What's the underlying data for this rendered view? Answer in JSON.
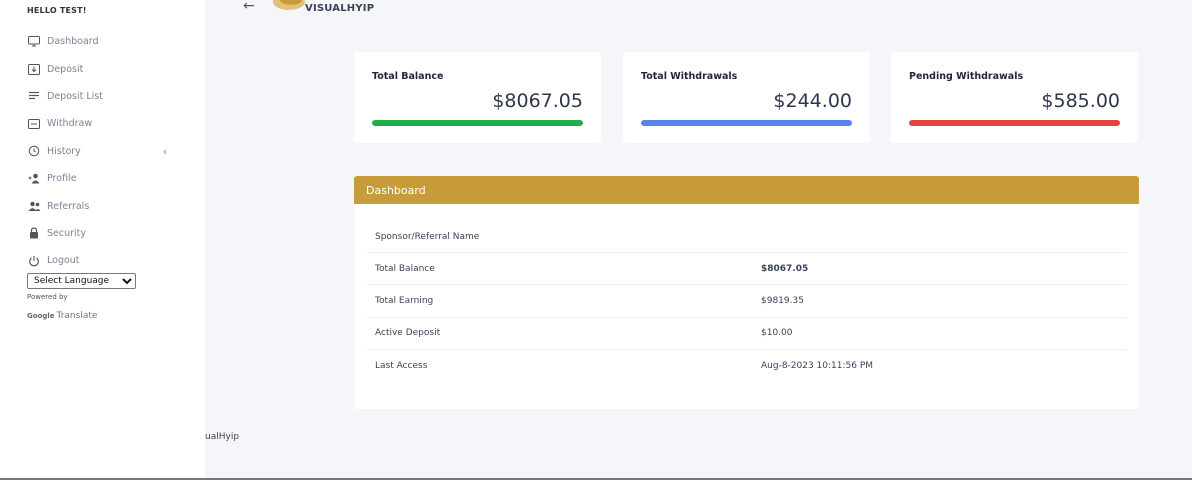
{
  "sidebar": {
    "greeting": "HELLO TEST!",
    "items": [
      {
        "label": "Dashboard",
        "icon": "monitor-icon"
      },
      {
        "label": "Deposit",
        "icon": "deposit-icon"
      },
      {
        "label": "Deposit List",
        "icon": "list-icon"
      },
      {
        "label": "Withdraw",
        "icon": "withdraw-icon"
      },
      {
        "label": "History",
        "icon": "history-icon",
        "caret": "‹"
      },
      {
        "label": "Profile",
        "icon": "profile-icon"
      },
      {
        "label": "Referrals",
        "icon": "users-icon"
      },
      {
        "label": "Security",
        "icon": "lock-icon"
      },
      {
        "label": "Logout",
        "icon": "power-icon"
      }
    ],
    "language_select": "Select Language",
    "powered_by": "Powered by",
    "google": "Google",
    "translate": "Translate"
  },
  "topbar": {
    "back": "←",
    "brand": "VISUALHYIP"
  },
  "cards": [
    {
      "title": "Total Balance",
      "value": "$8067.05",
      "color": "#20b04b"
    },
    {
      "title": "Total Withdrawals",
      "value": "$244.00",
      "color": "#5b82e8"
    },
    {
      "title": "Pending Withdrawals",
      "value": "$585.00",
      "color": "#e04443"
    }
  ],
  "panel": {
    "title": "Dashboard",
    "rows": [
      {
        "label": "Sponsor/Referral Name",
        "value": ""
      },
      {
        "label": "Total Balance",
        "value": "$8067.05"
      },
      {
        "label": "Total Earning",
        "value": "$9819.35"
      },
      {
        "label": "Active Deposit",
        "value": "$10.00"
      },
      {
        "label": "Last Access",
        "value": "Aug-8-2023 10:11:56 PM"
      }
    ]
  },
  "footer": {
    "text": "ualHyip"
  },
  "colors": {
    "accent": "#c99c3b",
    "balance_bar": "#20b04b",
    "withdrawals_bar": "#5b82e8",
    "pending_bar": "#e04443"
  }
}
